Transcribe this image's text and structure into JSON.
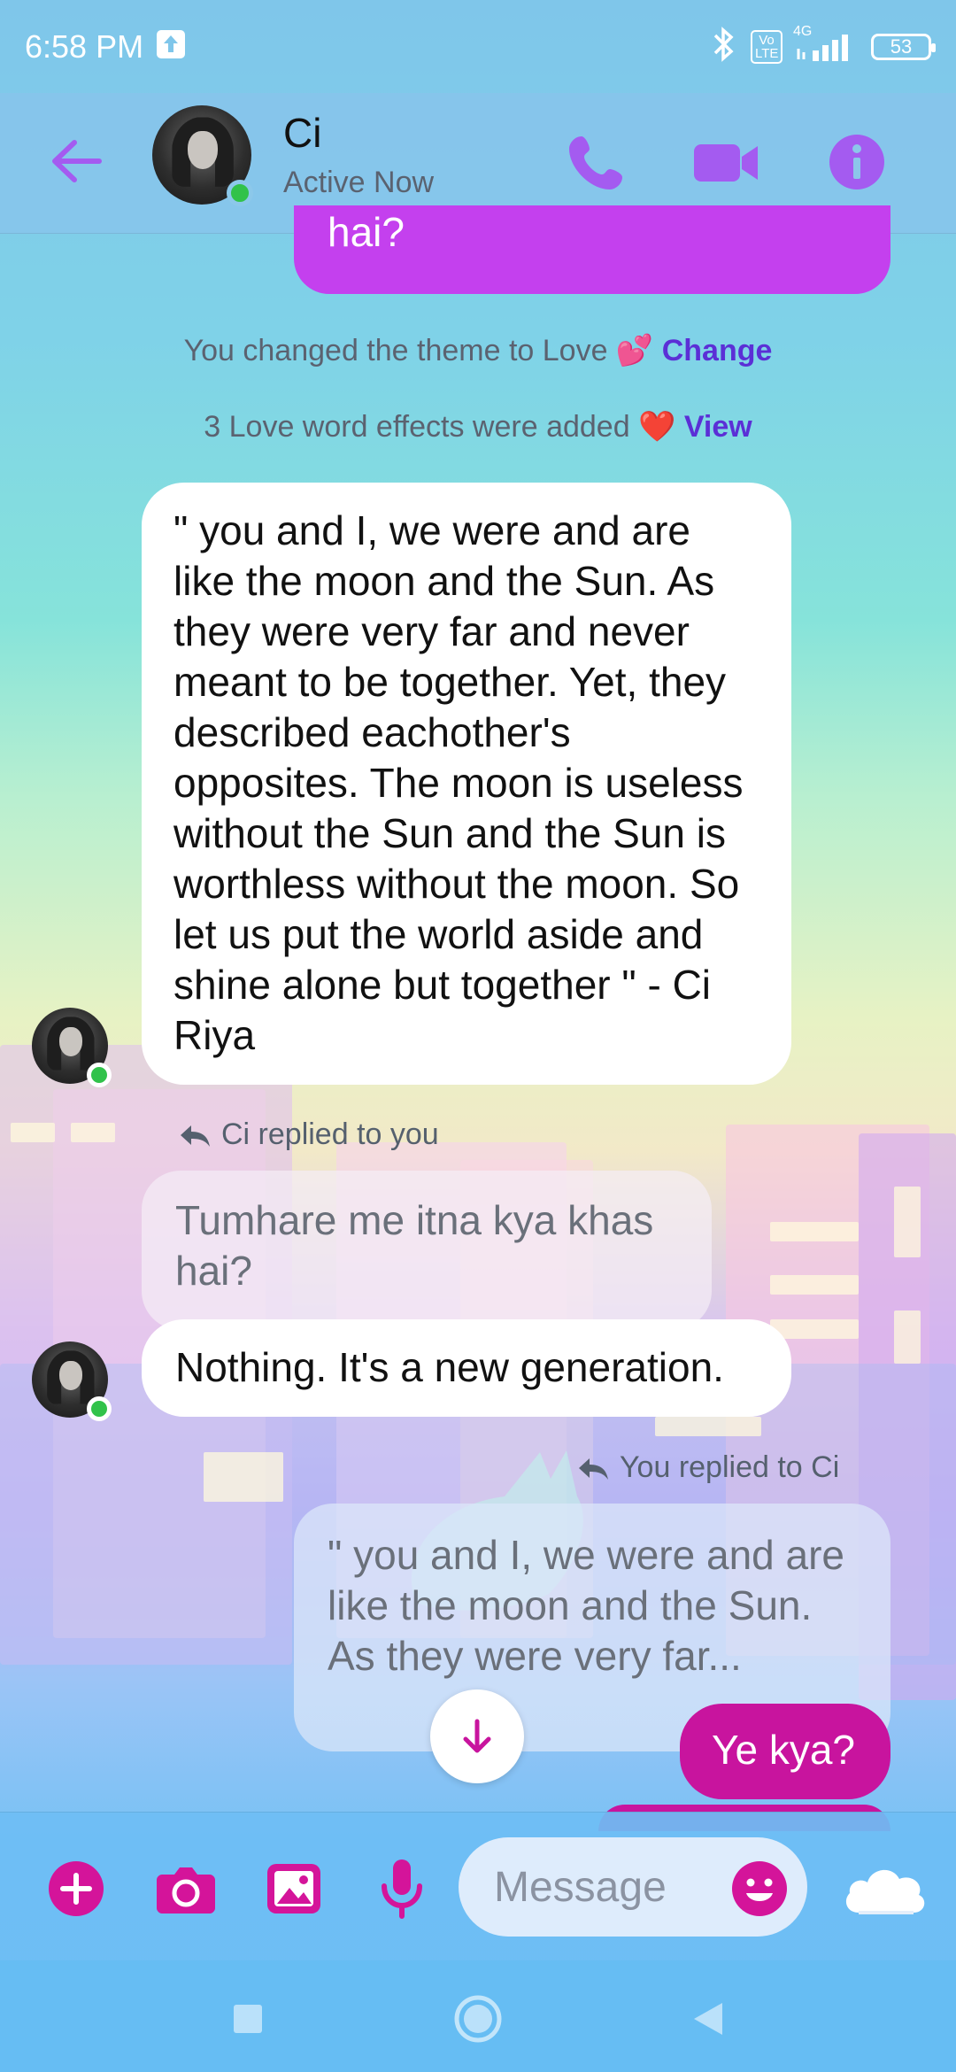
{
  "status_bar": {
    "time": "6:58 PM",
    "volte": "Vo LTE",
    "network": "4G",
    "battery": "53"
  },
  "header": {
    "contact_name": "Ci",
    "contact_status": "Active Now",
    "icons": [
      "back-arrow-icon",
      "phone-icon",
      "video-camera-icon",
      "info-icon"
    ],
    "accent": "#a45bf0"
  },
  "chat": {
    "top_partial_message": "hai?",
    "system_messages": [
      {
        "text": "You changed the theme to Love 💕",
        "link": "Change"
      },
      {
        "text": "3 Love word effects were added ❤️",
        "link": "View"
      }
    ],
    "quote_message": "\" you and I, we were and are like the moon and the Sun. As they were very far and never meant to be together. Yet, they described eachother's opposites. The moon is useless without the Sun and the Sun is worthless without the moon. So let us put the world aside and shine alone but together \" - Ci Riya",
    "reply_1": {
      "label": "Ci replied to you",
      "quoted": "Tumhare me itna kya khas hai?",
      "message": "Nothing. It's a new generation."
    },
    "reply_2": {
      "label": "You replied to Ci",
      "quoted": "\" you and I, we were and are like the moon and the Sun. As they were very far...",
      "message": "Ye kya?"
    }
  },
  "composer": {
    "placeholder": "Message",
    "icons": [
      "plus-icon",
      "camera-icon",
      "gallery-icon",
      "microphone-icon",
      "emoji-icon",
      "cloud-icon"
    ],
    "accent": "#d4149a"
  },
  "nav": {
    "icons": [
      "recent-apps-icon",
      "home-icon",
      "back-icon"
    ]
  }
}
